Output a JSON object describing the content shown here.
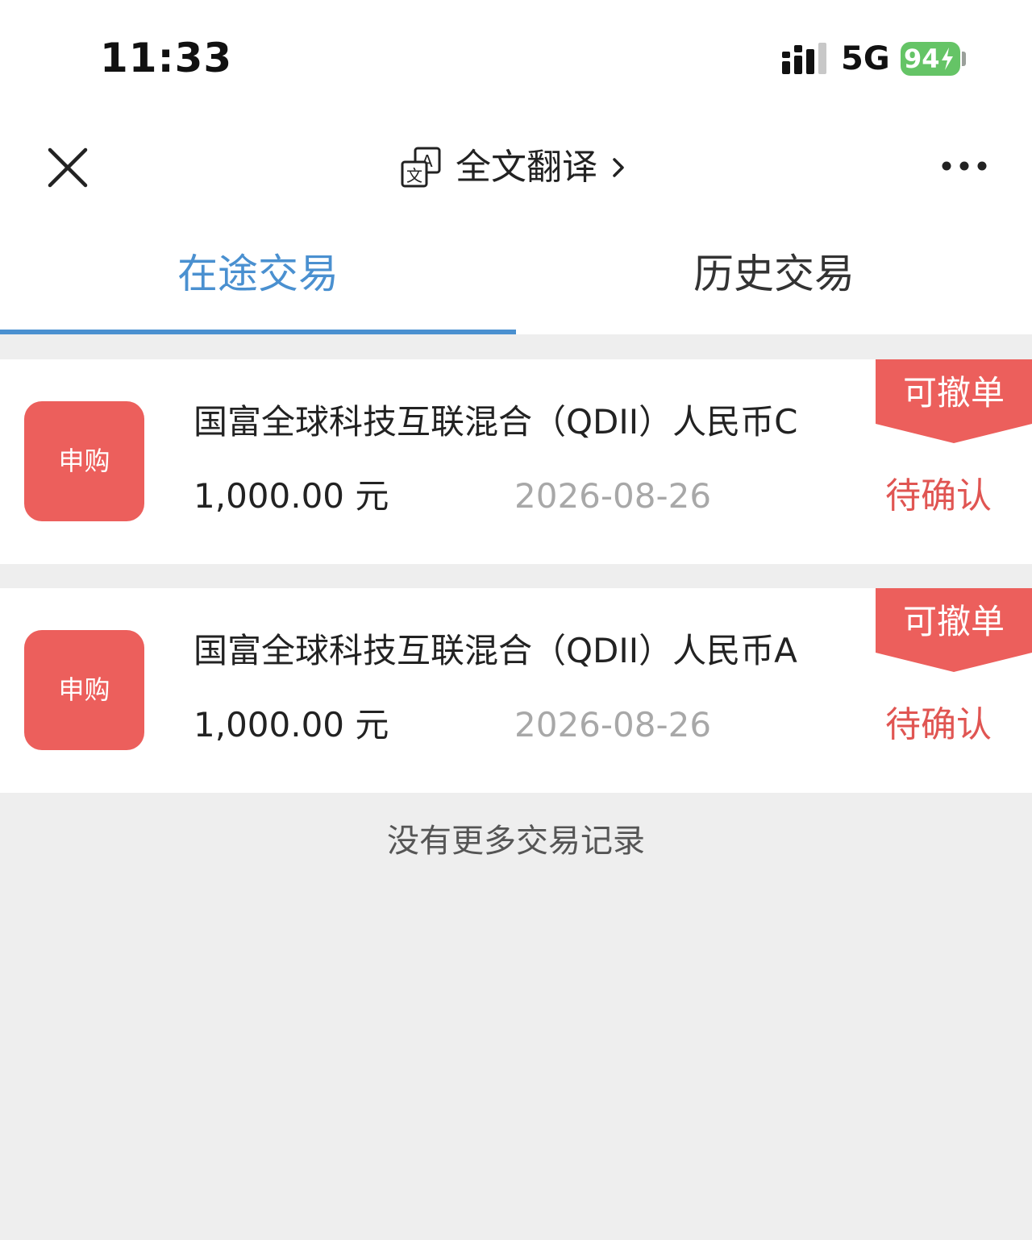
{
  "status_bar": {
    "time": "11:33",
    "network": "5G",
    "battery": "94"
  },
  "title_bar": {
    "translate_label": "全文翻译"
  },
  "tabs": [
    {
      "label": "在途交易",
      "active": true
    },
    {
      "label": "历史交易",
      "active": false
    }
  ],
  "transactions": [
    {
      "type": "申购",
      "fund_name": "国富全球科技互联混合（QDII）人民币C",
      "amount": "1,000.00 元",
      "date": "2026-08-26",
      "status": "待确认",
      "ribbon": "可撤单"
    },
    {
      "type": "申购",
      "fund_name": "国富全球科技互联混合（QDII）人民币A",
      "amount": "1,000.00 元",
      "date": "2026-08-26",
      "status": "待确认",
      "ribbon": "可撤单"
    }
  ],
  "footer": {
    "no_more": "没有更多交易记录"
  },
  "colors": {
    "accent_blue": "#4a90d0",
    "badge_red": "#ec5f5c",
    "status_red": "#e05552",
    "battery_green": "#65c466"
  }
}
